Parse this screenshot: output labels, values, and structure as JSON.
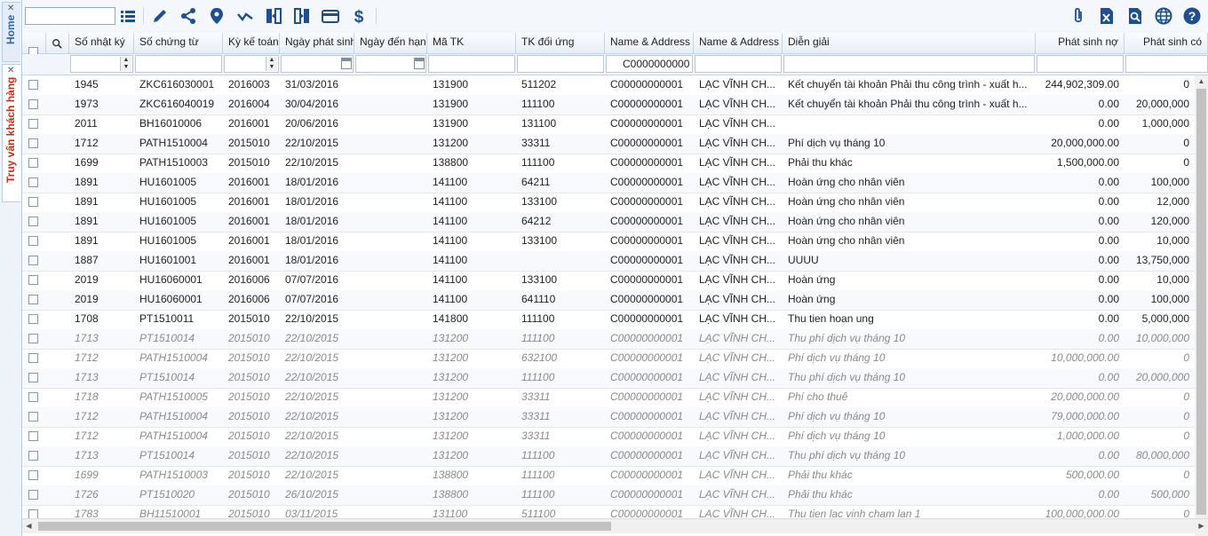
{
  "sidebar": {
    "home_label": "Home",
    "active_label": "Truy vấn khách hàng",
    "close_glyph": "✕"
  },
  "toolbar": {
    "search_value": "",
    "icons": [
      "list-icon",
      "edit-icon",
      "share-icon",
      "location-icon",
      "check-icon",
      "transfer-left-icon",
      "transfer-right-icon",
      "card-icon",
      "dollar-icon",
      "attachment-icon",
      "excel-icon",
      "preview-icon",
      "globe-icon",
      "help-icon"
    ]
  },
  "grid": {
    "columns": [
      "Số nhật ký",
      "Số chứng từ",
      "Kỳ kế toán",
      "Ngày phát sinh",
      "Ngày đến hạn",
      "Mã TK",
      "TK đối ứng",
      "Name & Address",
      "Name & Address",
      "Diễn giải",
      "Phát sinh nợ",
      "Phát sinh có"
    ],
    "filters": {
      "name_code": "C0000000000"
    },
    "rows": [
      {
        "j": "1945",
        "doc": "ZKC616030001",
        "period": "2016003",
        "date": "31/03/2016",
        "due": "",
        "acc": "131900",
        "contra": "511202",
        "code": "C00000000001",
        "name": "LẠC VĨNH CH...",
        "desc": "Kết chuyển tài khoản Phải thu công trình - xuất h...",
        "debit": "244,902,309.00",
        "credit": "0",
        "inactive": false
      },
      {
        "j": "1973",
        "doc": "ZKC616040019",
        "period": "2016004",
        "date": "30/04/2016",
        "due": "",
        "acc": "131900",
        "contra": "111100",
        "code": "C00000000001",
        "name": "LẠC VĨNH CH...",
        "desc": "Kết chuyển tài khoản Phải thu công trình - xuất h...",
        "debit": "0.00",
        "credit": "20,000,000",
        "inactive": false
      },
      {
        "j": "2011",
        "doc": "BH16010006",
        "period": "2016001",
        "date": "20/06/2016",
        "due": "",
        "acc": "131900",
        "contra": "131100",
        "code": "C00000000001",
        "name": "LẠC VĨNH CH...",
        "desc": "",
        "debit": "0.00",
        "credit": "1,000,000",
        "inactive": false
      },
      {
        "j": "1712",
        "doc": "PATH1510004",
        "period": "2015010",
        "date": "22/10/2015",
        "due": "",
        "acc": "131200",
        "contra": "33311",
        "code": "C00000000001",
        "name": "LẠC VĨNH CH...",
        "desc": "Phí dịch vụ tháng 10",
        "debit": "20,000,000.00",
        "credit": "0",
        "inactive": false
      },
      {
        "j": "1699",
        "doc": "PATH1510003",
        "period": "2015010",
        "date": "22/10/2015",
        "due": "",
        "acc": "138800",
        "contra": "111100",
        "code": "C00000000001",
        "name": "LẠC VĨNH CH...",
        "desc": "Phải thu khác",
        "debit": "1,500,000.00",
        "credit": "0",
        "inactive": false
      },
      {
        "j": "1891",
        "doc": "HU1601005",
        "period": "2016001",
        "date": "18/01/2016",
        "due": "",
        "acc": "141100",
        "contra": "64211",
        "code": "C00000000001",
        "name": "LẠC VĨNH CH...",
        "desc": "Hoàn ứng cho nhân viên",
        "debit": "0.00",
        "credit": "100,000",
        "inactive": false
      },
      {
        "j": "1891",
        "doc": "HU1601005",
        "period": "2016001",
        "date": "18/01/2016",
        "due": "",
        "acc": "141100",
        "contra": "133100",
        "code": "C00000000001",
        "name": "LẠC VĨNH CH...",
        "desc": "Hoàn ứng cho nhân viên",
        "debit": "0.00",
        "credit": "12,000",
        "inactive": false
      },
      {
        "j": "1891",
        "doc": "HU1601005",
        "period": "2016001",
        "date": "18/01/2016",
        "due": "",
        "acc": "141100",
        "contra": "64212",
        "code": "C00000000001",
        "name": "LẠC VĨNH CH...",
        "desc": "Hoàn ứng cho nhân viên",
        "debit": "0.00",
        "credit": "120,000",
        "inactive": false
      },
      {
        "j": "1891",
        "doc": "HU1601005",
        "period": "2016001",
        "date": "18/01/2016",
        "due": "",
        "acc": "141100",
        "contra": "133100",
        "code": "C00000000001",
        "name": "LẠC VĨNH CH...",
        "desc": "Hoàn ứng cho nhân viên",
        "debit": "0.00",
        "credit": "10,000",
        "inactive": false
      },
      {
        "j": "1887",
        "doc": "HU1601001",
        "period": "2016001",
        "date": "18/01/2016",
        "due": "",
        "acc": "141100",
        "contra": "",
        "code": "C00000000001",
        "name": "LẠC VĨNH CH...",
        "desc": "UUUU",
        "debit": "0.00",
        "credit": "13,750,000",
        "inactive": false
      },
      {
        "j": "2019",
        "doc": "HU16060001",
        "period": "2016006",
        "date": "07/07/2016",
        "due": "",
        "acc": "141100",
        "contra": "133100",
        "code": "C00000000001",
        "name": "LẠC VĨNH CH...",
        "desc": "Hoàn ứng",
        "debit": "0.00",
        "credit": "10,000",
        "inactive": false
      },
      {
        "j": "2019",
        "doc": "HU16060001",
        "period": "2016006",
        "date": "07/07/2016",
        "due": "",
        "acc": "141100",
        "contra": "641110",
        "code": "C00000000001",
        "name": "LẠC VĨNH CH...",
        "desc": "Hoàn ứng",
        "debit": "0.00",
        "credit": "100,000",
        "inactive": false
      },
      {
        "j": "1708",
        "doc": "PT1510011",
        "period": "2015010",
        "date": "22/10/2015",
        "due": "",
        "acc": "141800",
        "contra": "111100",
        "code": "C00000000001",
        "name": "LẠC VĨNH CH...",
        "desc": "Thu tien hoan ung",
        "debit": "0.00",
        "credit": "5,000,000",
        "inactive": false
      },
      {
        "j": "1713",
        "doc": "PT1510014",
        "period": "2015010",
        "date": "22/10/2015",
        "due": "",
        "acc": "131200",
        "contra": "111100",
        "code": "C00000000001",
        "name": "LẠC VĨNH CH...",
        "desc": "Thu phí dịch vụ tháng 10",
        "debit": "0.00",
        "credit": "10,000,000",
        "inactive": true
      },
      {
        "j": "1712",
        "doc": "PATH1510004",
        "period": "2015010",
        "date": "22/10/2015",
        "due": "",
        "acc": "131200",
        "contra": "632100",
        "code": "C00000000001",
        "name": "LẠC VĨNH CH...",
        "desc": "Phí dịch vụ tháng 10",
        "debit": "10,000,000.00",
        "credit": "0",
        "inactive": true
      },
      {
        "j": "1713",
        "doc": "PT1510014",
        "period": "2015010",
        "date": "22/10/2015",
        "due": "",
        "acc": "131200",
        "contra": "111100",
        "code": "C00000000001",
        "name": "LẠC VĨNH CH...",
        "desc": "Thu phí dịch vụ tháng 10",
        "debit": "0.00",
        "credit": "20,000,000",
        "inactive": true
      },
      {
        "j": "1718",
        "doc": "PATH1510005",
        "period": "2015010",
        "date": "22/10/2015",
        "due": "",
        "acc": "131200",
        "contra": "33311",
        "code": "C00000000001",
        "name": "LẠC VĨNH CH...",
        "desc": "Phí cho thuê",
        "debit": "20,000,000.00",
        "credit": "0",
        "inactive": true
      },
      {
        "j": "1712",
        "doc": "PATH1510004",
        "period": "2015010",
        "date": "22/10/2015",
        "due": "",
        "acc": "131200",
        "contra": "33311",
        "code": "C00000000001",
        "name": "LẠC VĨNH CH...",
        "desc": "Phí dịch vụ tháng 10",
        "debit": "79,000,000.00",
        "credit": "0",
        "inactive": true
      },
      {
        "j": "1712",
        "doc": "PATH1510004",
        "period": "2015010",
        "date": "22/10/2015",
        "due": "",
        "acc": "131200",
        "contra": "33311",
        "code": "C00000000001",
        "name": "LẠC VĨNH CH...",
        "desc": "Phí dịch vụ tháng 10",
        "debit": "1,000,000.00",
        "credit": "0",
        "inactive": true
      },
      {
        "j": "1713",
        "doc": "PT1510014",
        "period": "2015010",
        "date": "22/10/2015",
        "due": "",
        "acc": "131200",
        "contra": "111100",
        "code": "C00000000001",
        "name": "LẠC VĨNH CH...",
        "desc": "Thu phí dịch vụ tháng 10",
        "debit": "0.00",
        "credit": "80,000,000",
        "inactive": true
      },
      {
        "j": "1699",
        "doc": "PATH1510003",
        "period": "2015010",
        "date": "22/10/2015",
        "due": "",
        "acc": "138800",
        "contra": "111100",
        "code": "C00000000001",
        "name": "LẠC VĨNH CH...",
        "desc": "Phải thu khác",
        "debit": "500,000.00",
        "credit": "0",
        "inactive": true
      },
      {
        "j": "1726",
        "doc": "PT1510020",
        "period": "2015010",
        "date": "26/10/2015",
        "due": "",
        "acc": "138800",
        "contra": "111100",
        "code": "C00000000001",
        "name": "LẠC VĨNH CH...",
        "desc": "Phải thu khác",
        "debit": "0.00",
        "credit": "500,000",
        "inactive": true
      },
      {
        "j": "1783",
        "doc": "BH11510001",
        "period": "2015010",
        "date": "03/11/2015",
        "due": "",
        "acc": "131100",
        "contra": "511100",
        "code": "C00000000001",
        "name": "LẠC VĨNH CH...",
        "desc": "Thu tien lac vinh cham lan 1",
        "debit": "100,000,000.00",
        "credit": "0",
        "inactive": true
      }
    ]
  }
}
